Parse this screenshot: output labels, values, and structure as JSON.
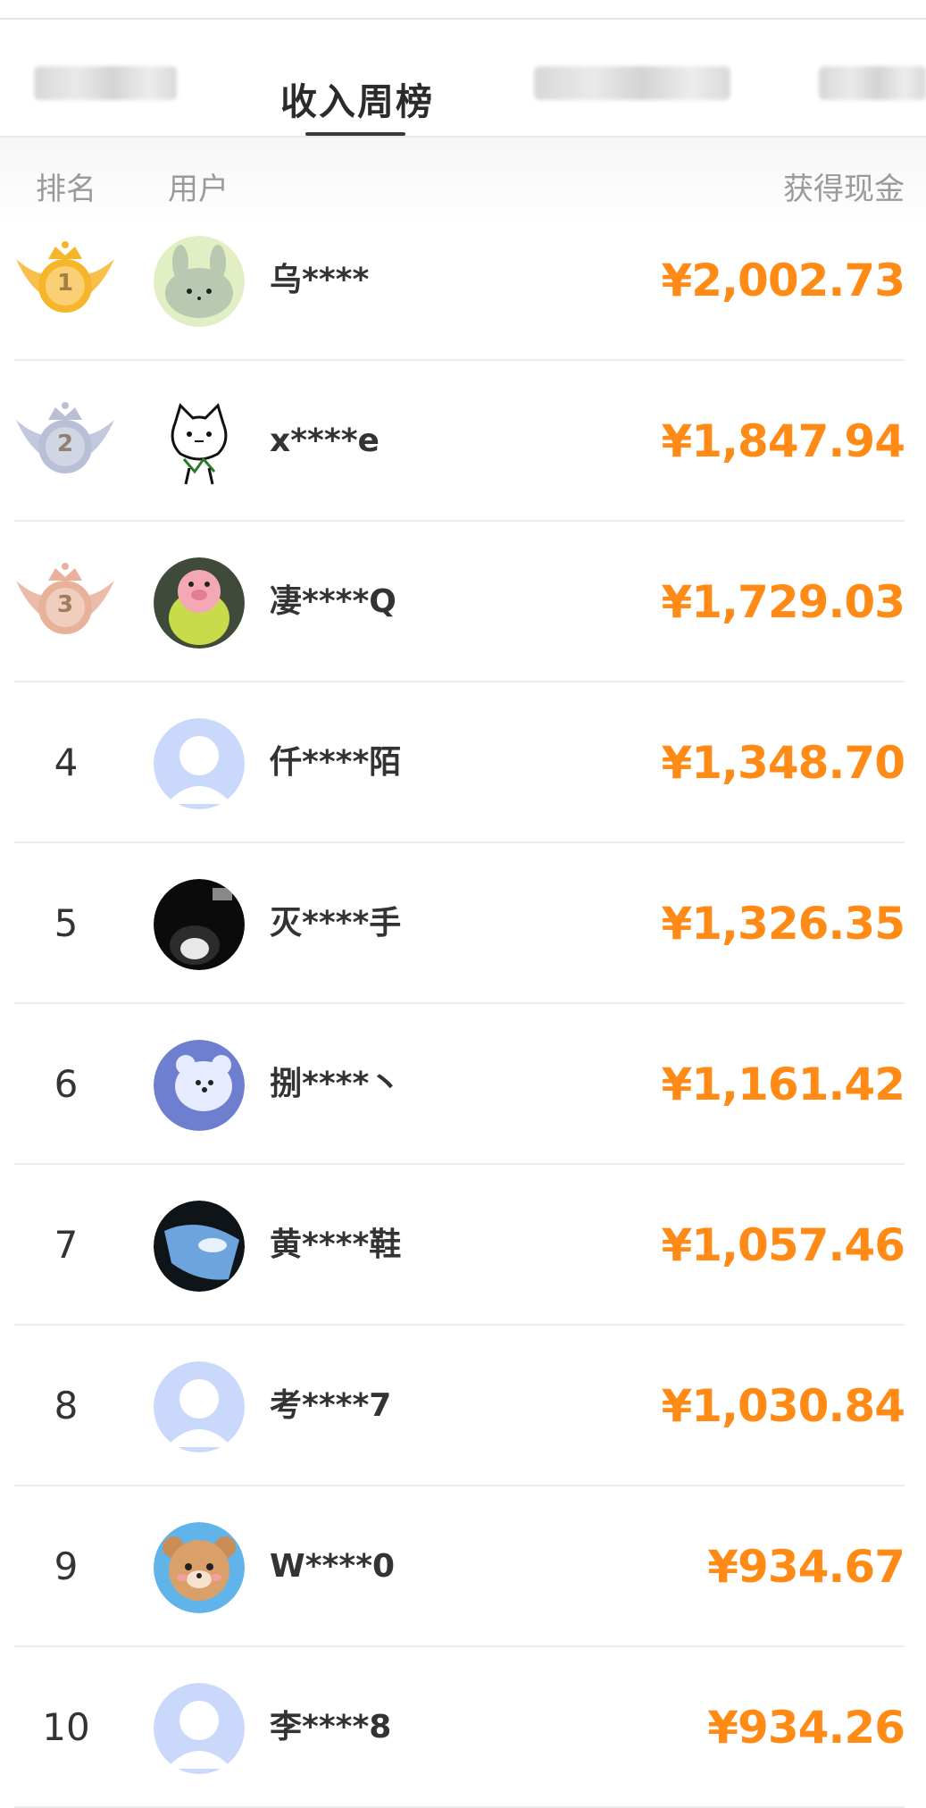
{
  "tabs": [
    {
      "label": "",
      "blurred": true
    },
    {
      "label": "收入周榜",
      "active": true
    },
    {
      "label": "",
      "blurred": true
    },
    {
      "label": "",
      "blurred": true
    }
  ],
  "header": {
    "rank": "排名",
    "user": "用户",
    "cash": "获得现金"
  },
  "colors": {
    "amount": "#ff8a16",
    "gold": "#f7b52b",
    "silver": "#b9bfd6",
    "bronze": "#e8b29a"
  },
  "rows": [
    {
      "rank": "1",
      "medal": "gold-medal-icon",
      "avatar": "rabbit-avatar",
      "name": "乌****",
      "amount": "¥2,002.73"
    },
    {
      "rank": "2",
      "medal": "silver-medal-icon",
      "avatar": "cat-sketch-avatar",
      "name": "x****e",
      "amount": "¥1,847.94"
    },
    {
      "rank": "3",
      "medal": "bronze-medal-icon",
      "avatar": "pig-avatar",
      "name": "凄****Q",
      "amount": "¥1,729.03"
    },
    {
      "rank": "4",
      "avatar": "default-avatar",
      "name": "仟****陌",
      "amount": "¥1,348.70"
    },
    {
      "rank": "5",
      "avatar": "dark-photo-avatar",
      "name": "灭****手",
      "amount": "¥1,326.35"
    },
    {
      "rank": "6",
      "avatar": "cloud-bear-avatar",
      "name": "捌****丶",
      "amount": "¥1,161.42"
    },
    {
      "rank": "7",
      "avatar": "sky-window-avatar",
      "name": "黄****鞋",
      "amount": "¥1,057.46"
    },
    {
      "rank": "8",
      "avatar": "default-avatar",
      "name": "考****7",
      "amount": "¥1,030.84"
    },
    {
      "rank": "9",
      "avatar": "bear-avatar",
      "name": "W****0",
      "amount": "¥934.67"
    },
    {
      "rank": "10",
      "avatar": "default-avatar",
      "name": "李****8",
      "amount": "¥934.26"
    }
  ]
}
